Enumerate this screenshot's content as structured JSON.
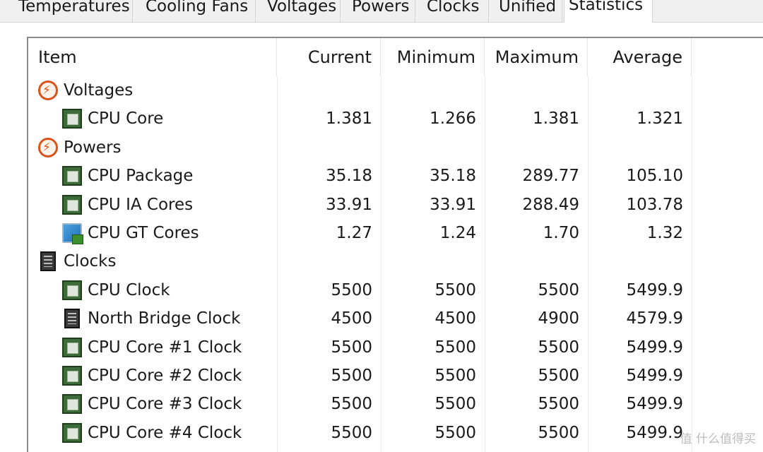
{
  "tabs": [
    {
      "label": "Temperatures"
    },
    {
      "label": "Cooling Fans"
    },
    {
      "label": "Voltages"
    },
    {
      "label": "Powers"
    },
    {
      "label": "Clocks"
    },
    {
      "label": "Unified"
    },
    {
      "label": "Statistics",
      "active": true
    }
  ],
  "columns": {
    "item": "Item",
    "current": "Current",
    "minimum": "Minimum",
    "maximum": "Maximum",
    "average": "Average"
  },
  "rows": [
    {
      "type": "group",
      "icon": "bolt-icon",
      "label": "Voltages"
    },
    {
      "type": "sensor",
      "icon": "cpu-chip-icon",
      "label": "CPU Core",
      "current": "1.381",
      "minimum": "1.266",
      "maximum": "1.381",
      "average": "1.321"
    },
    {
      "type": "group",
      "icon": "bolt-icon",
      "label": "Powers"
    },
    {
      "type": "sensor",
      "icon": "cpu-chip-icon",
      "label": "CPU Package",
      "current": "35.18",
      "minimum": "35.18",
      "maximum": "289.77",
      "average": "105.10"
    },
    {
      "type": "sensor",
      "icon": "cpu-chip-icon",
      "label": "CPU IA Cores",
      "current": "33.91",
      "minimum": "33.91",
      "maximum": "288.49",
      "average": "103.78"
    },
    {
      "type": "sensor",
      "icon": "monitor-icon",
      "label": "CPU GT Cores",
      "current": "1.27",
      "minimum": "1.24",
      "maximum": "1.70",
      "average": "1.32"
    },
    {
      "type": "group",
      "icon": "memory-chip-icon",
      "label": "Clocks"
    },
    {
      "type": "sensor",
      "icon": "cpu-chip-icon",
      "label": "CPU Clock",
      "current": "5500",
      "minimum": "5500",
      "maximum": "5500",
      "average": "5499.9"
    },
    {
      "type": "sensor",
      "icon": "memory-chip-icon",
      "label": "North Bridge Clock",
      "current": "4500",
      "minimum": "4500",
      "maximum": "4900",
      "average": "4579.9"
    },
    {
      "type": "sensor",
      "icon": "cpu-chip-icon",
      "label": "CPU Core #1 Clock",
      "current": "5500",
      "minimum": "5500",
      "maximum": "5500",
      "average": "5499.9"
    },
    {
      "type": "sensor",
      "icon": "cpu-chip-icon",
      "label": "CPU Core #2 Clock",
      "current": "5500",
      "minimum": "5500",
      "maximum": "5500",
      "average": "5499.9"
    },
    {
      "type": "sensor",
      "icon": "cpu-chip-icon",
      "label": "CPU Core #3 Clock",
      "current": "5500",
      "minimum": "5500",
      "maximum": "5500",
      "average": "5499.9"
    },
    {
      "type": "sensor",
      "icon": "cpu-chip-icon",
      "label": "CPU Core #4 Clock",
      "current": "5500",
      "minimum": "5500",
      "maximum": "5500",
      "average": "5499.9"
    }
  ],
  "watermark": "值 什么值得买"
}
